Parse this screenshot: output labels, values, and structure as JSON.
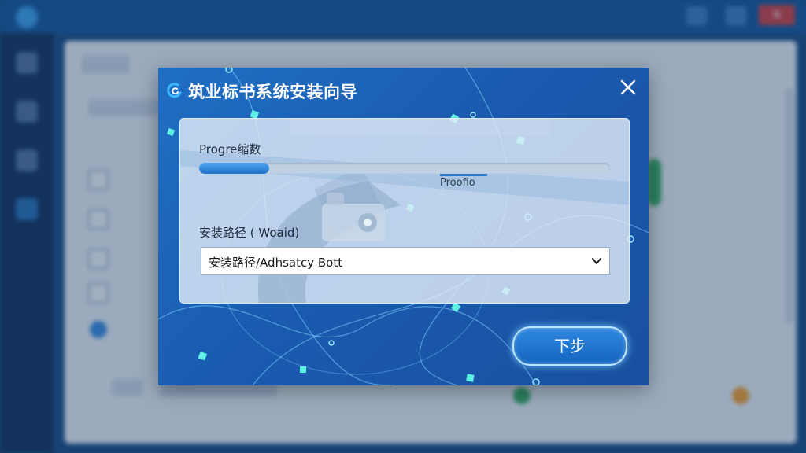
{
  "dialog": {
    "title": "筑业标书系统安装向导",
    "progress": {
      "label": "Progre缩数",
      "value": 0.17,
      "status": "Proofio"
    },
    "install_path": {
      "label": "安装路径 ( Woaid)",
      "value": "安装路径/Adhsatcy Bott"
    },
    "next_label": "下步",
    "close_symbol": "✕"
  },
  "background_app": {
    "close_symbol": "✕"
  },
  "icons": {
    "dialog_logo": "spinner-logo-icon",
    "close": "close-icon",
    "dropdown": "chevron-down-icon"
  },
  "colors": {
    "dialog_bg": "#1a5bb0",
    "accent": "#1f73cc",
    "button_glow": "#78d2ff"
  }
}
